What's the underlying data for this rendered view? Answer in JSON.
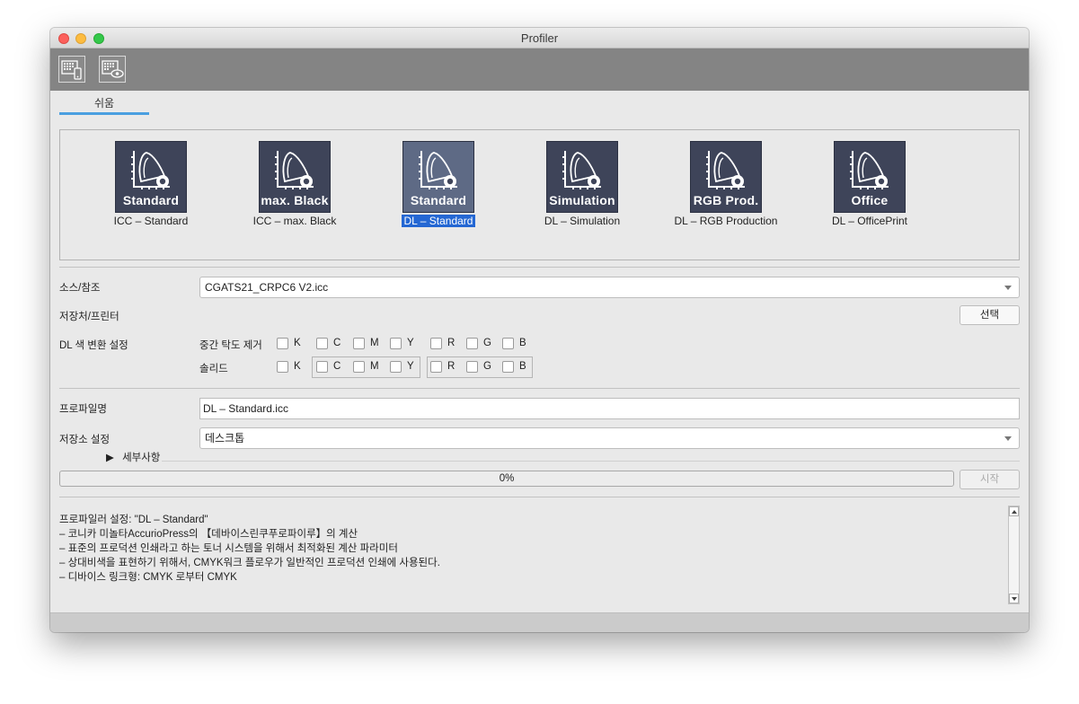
{
  "window": {
    "title": "Profiler"
  },
  "toolbar": {
    "icons": [
      "chart-device-icon",
      "chart-view-icon"
    ]
  },
  "tabs": [
    {
      "label": "쉬움",
      "active": true
    }
  ],
  "presets": [
    {
      "tile_text": "Standard",
      "caption": "ICC – Standard",
      "selected": false
    },
    {
      "tile_text": "max. Black",
      "caption": "ICC – max. Black",
      "selected": false
    },
    {
      "tile_text": "Standard",
      "caption": "DL – Standard",
      "selected": true
    },
    {
      "tile_text": "Simulation",
      "caption": "DL – Simulation",
      "selected": false
    },
    {
      "tile_text": "RGB Prod.",
      "caption": "DL – RGB Production",
      "selected": false
    },
    {
      "tile_text": "Office",
      "caption": "DL – OfficePrint",
      "selected": false
    }
  ],
  "source": {
    "label": "소스/참조",
    "value": "CGATS21_CRPC6 V2.icc"
  },
  "destination": {
    "label": "저장처/프린터",
    "select_button": "선택"
  },
  "dl_settings": {
    "label": "DL 색 변환 설정",
    "gray_removal": {
      "label": "중간 탁도 제거",
      "channels": [
        "K",
        "C",
        "M",
        "Y",
        "R",
        "G",
        "B"
      ]
    },
    "solid": {
      "label": "솔리드",
      "channels": [
        "K",
        "C",
        "M",
        "Y",
        "R",
        "G",
        "B"
      ]
    }
  },
  "profile_name": {
    "label": "프로파일명",
    "value": "DL – Standard.icc"
  },
  "save_location": {
    "label": "저장소 설정",
    "value": "데스크톱"
  },
  "details": {
    "label": "세부사항"
  },
  "progress": {
    "value": 0,
    "text": "0%",
    "start_button": "시작"
  },
  "description": [
    "프로파일러 설정: \"DL – Standard\"",
    "– 코니카 미놀타AccurioPress의 【데바이스린쿠푸로파이루】의 계산",
    "– 표준의 프로덕션 인쇄라고 하는 토너 시스템을 위해서 최적화된 계산 파라미터",
    "– 상대비색을 표현하기 위해서, CMYK워크 플로우가 일반적인 프로덕션 인쇄에 사용된다.",
    "– 디바이스 링크형: CMYK 로부터 CMYK"
  ],
  "colors": {
    "accent": "#4a9fe0",
    "selection": "#2467d3",
    "tile": "#3e4459",
    "tile_selected": "#5e6a85",
    "toolbar": "#848484"
  }
}
